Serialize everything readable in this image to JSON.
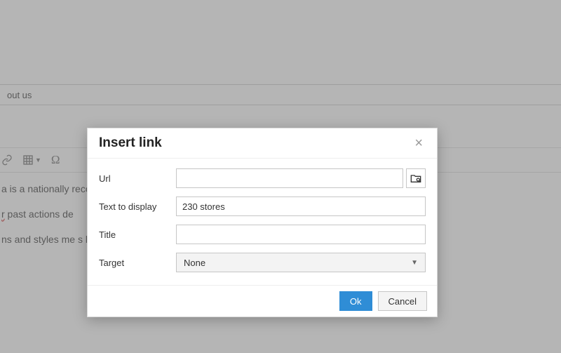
{
  "tab": {
    "label": "out us"
  },
  "body_text": {
    "line1": "a is a nationally recognized sports brand catering adults and kids about active lifestyles – and i",
    "line2_a": "r",
    "line2_b": " past actions de",
    "line3": "ns and styles me                                                                                                      s have deep roots in yoga"
  },
  "dialog": {
    "title": "Insert link",
    "labels": {
      "url": "Url",
      "text": "Text to display",
      "title": "Title",
      "target": "Target"
    },
    "values": {
      "url": "",
      "text": "230 stores",
      "title": "",
      "target": "None"
    },
    "buttons": {
      "ok": "Ok",
      "cancel": "Cancel"
    }
  }
}
